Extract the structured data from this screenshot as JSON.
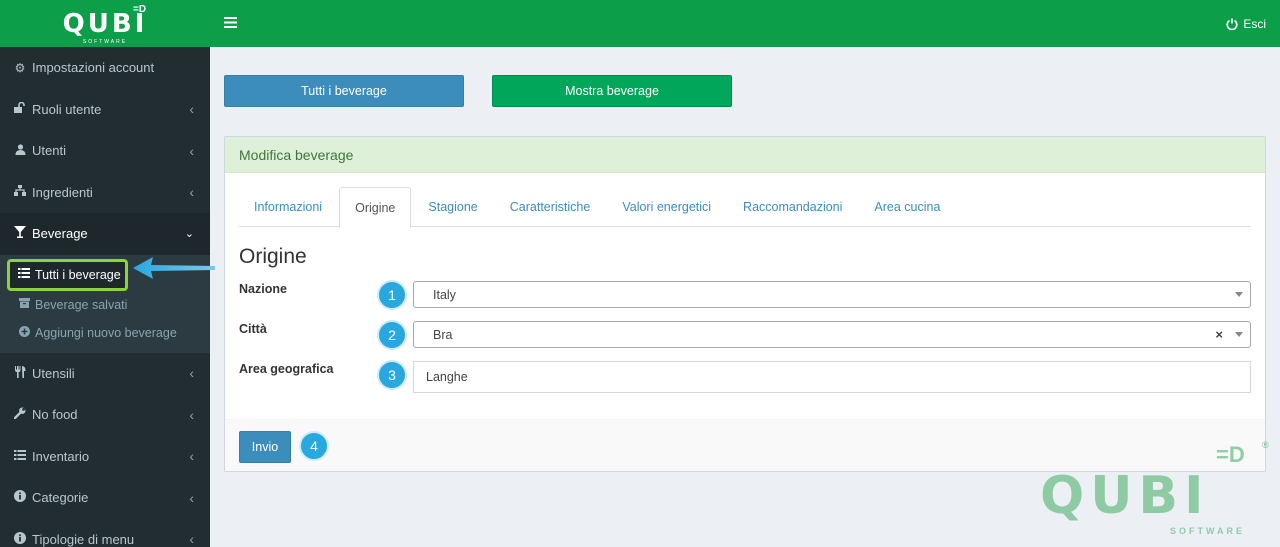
{
  "brand": {
    "name": "QUBI",
    "sub": "SOFTWARE"
  },
  "navbar": {
    "logout_label": "Esci"
  },
  "sidebar": {
    "items_top": [
      {
        "label": "Impostazioni account",
        "icon": "gear-icon",
        "glyph": "⚙"
      },
      {
        "label": "Ruoli utente",
        "icon": "unlock-icon",
        "glyph": "🔓"
      },
      {
        "label": "Utenti",
        "icon": "user-icon",
        "glyph": "👤"
      },
      {
        "label": "Ingredienti",
        "icon": "sitemap-icon",
        "glyph": "▣"
      },
      {
        "label": "Beverage",
        "icon": "glass-icon",
        "glyph": "Y"
      }
    ],
    "submenu": [
      {
        "label": "Tutti i beverage",
        "icon": "list-icon"
      },
      {
        "label": "Beverage salvati",
        "icon": "archive-icon"
      },
      {
        "label": "Aggiungi nuovo beverage",
        "icon": "plus-circle-icon"
      }
    ],
    "items_bottom": [
      {
        "label": "Utensili",
        "icon": "cutlery-icon",
        "glyph": "🍴"
      },
      {
        "label": "No food",
        "icon": "wrench-icon",
        "glyph": "🔧"
      },
      {
        "label": "Inventario",
        "icon": "list-icon",
        "glyph": "☰"
      },
      {
        "label": "Categorie",
        "icon": "info-icon",
        "glyph": "ℹ"
      },
      {
        "label": "Tipologie di menu",
        "icon": "info-icon",
        "glyph": "ℹ"
      }
    ]
  },
  "top_buttons": {
    "all_label": "Tutti i beverage",
    "show_label": "Mostra beverage"
  },
  "box": {
    "title": "Modifica beverage",
    "tabs": [
      "Informazioni",
      "Origine",
      "Stagione",
      "Caratteristiche",
      "Valori energetici",
      "Raccomandazioni",
      "Area cucina"
    ],
    "active_tab": "Origine",
    "section_title": "Origine",
    "fields": {
      "nazione": {
        "label": "Nazione",
        "value": "Italy",
        "badge": "1"
      },
      "citta": {
        "label": "Città",
        "value": "Bra",
        "badge": "2"
      },
      "area": {
        "label": "Area geografica",
        "value": "Langhe",
        "badge": "3"
      }
    },
    "submit_label": "Invio",
    "submit_badge": "4"
  },
  "watermark": {
    "name": "QUBI",
    "sub": "SOFTWARE",
    "reg": "®"
  },
  "colors": {
    "brand_green": "#0d9e4a",
    "primary_blue": "#3c8dbc",
    "success_green": "#00a65a",
    "sidebar_bg": "#222d32",
    "highlight": "#8cd23c",
    "callout_blue": "#29a8e0"
  }
}
